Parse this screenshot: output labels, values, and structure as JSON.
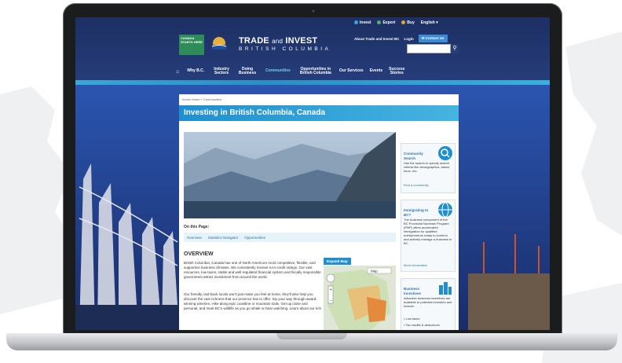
{
  "util": {
    "invest": "Invest",
    "export": "Export",
    "buy": "Buy",
    "lang": "English ▾"
  },
  "links": {
    "about": "About Trade and Invest BC",
    "login": "Login",
    "contact": "Contact Us"
  },
  "badge": {
    "text": "CANADA STARTS HERE"
  },
  "brand": {
    "line1": "TRADE",
    "and": "and",
    "line1b": "INVEST",
    "line2": "BRITISH COLUMBIA"
  },
  "nav": [
    {
      "label": "Why B.C."
    },
    {
      "label": "Industry\nSectors"
    },
    {
      "label": "Doing\nBusiness"
    },
    {
      "label": "Communities"
    },
    {
      "label": "Opportunities in\nBritish Columbia"
    },
    {
      "label": "Our Services"
    },
    {
      "label": "Events"
    },
    {
      "label": "Success\nStories"
    }
  ],
  "breadcrumb": "Invest Home » Communities",
  "title": "Investing in British Columbia, Canada",
  "on_this_page": "On this Page:",
  "tabs": [
    "Overview",
    "Statistics Navigator",
    "Opportunities"
  ],
  "overview": "OVERVIEW",
  "para1": "British Columbia, Canada has one of North America's most competitive, flexible, and supportive business climates. We consistently receive AAA credit ratings. Our vast resources, low taxes, stable and well-regulated financial system and fiscally responsible government attract investment from around the world.",
  "para2": "Our friendly, laid-back locals won't just make you feel at home, they'll also help you discover the vast richness that our province has to offer. Sip your way through award-winning wineries. Hike along epic coastline or mountain trails. Get up close and personal, and meet BC's wildlife as you go whale or bear watching. Learn about our rich",
  "expand_map": "Expand Map",
  "map_select": "Map",
  "sidebar": [
    {
      "title": "Community Search",
      "desc": "Use the search to specify search criteria like demographics, labour force, etc.",
      "link": "Find a community"
    },
    {
      "title": "Immigrating to BC?",
      "desc": "The business component of the BC Provincial Nominee Program (PNP) offers accelerated immigration for qualified entrepreneurs ready to invest in and actively manage a business in BC.",
      "link": "More information"
    },
    {
      "title": "Business Incentives",
      "desc": "Attractive business incentives are available to potential investors and include:",
      "link": "• Low taxes"
    },
    {
      "extra": "• Tax credits & deductions"
    }
  ],
  "colors": {
    "accent": "#1f8fcf",
    "nav_bg": "#1d2f63",
    "active": "#6fd0f0"
  }
}
